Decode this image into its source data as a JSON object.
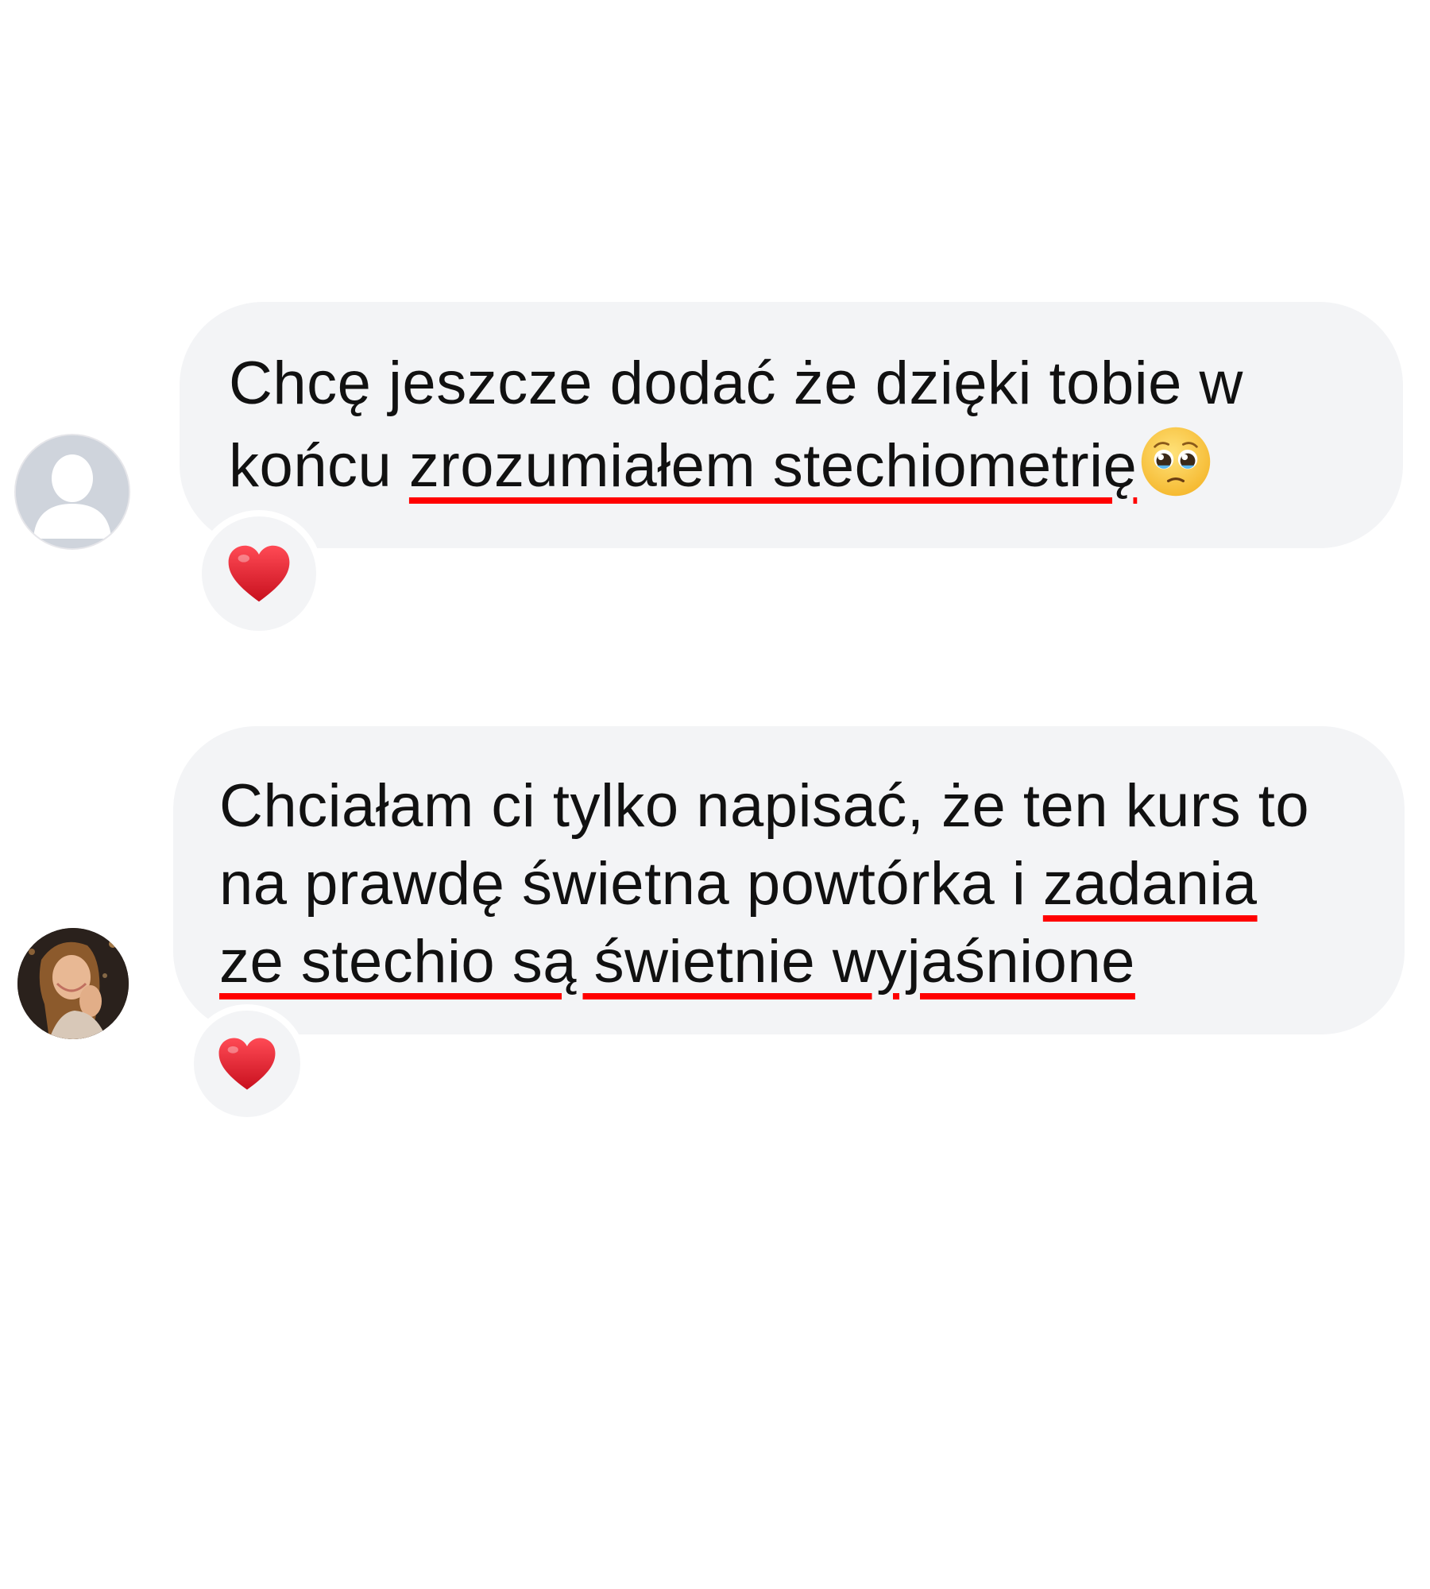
{
  "messages": [
    {
      "lines": [
        {
          "plain": "Chcę jeszcze dodać że dzięki tobie w",
          "underlined": ""
        },
        {
          "plain": "końcu ",
          "underlined": "zrozumiałem stechiometrię"
        }
      ],
      "trailing_emoji": "pleading-face-emoji",
      "reaction": "red-heart",
      "avatar": "default-profile-placeholder"
    },
    {
      "lines": [
        {
          "plain": "Chciałam ci tylko napisać, że ten kurs to",
          "underlined": ""
        },
        {
          "plain": "na prawdę świetna powtórka i ",
          "underlined": "zadania"
        },
        {
          "plain": "",
          "underlined": "ze stechio są świetnie wyjaśnione"
        }
      ],
      "reaction": "red-heart",
      "avatar": "user-photo"
    }
  ],
  "colors": {
    "bubble": "#f3f4f6",
    "text": "#111111",
    "underline": "#ff0000",
    "heart": "#e0202e",
    "placeholder_avatar": "#cfd4dc"
  }
}
